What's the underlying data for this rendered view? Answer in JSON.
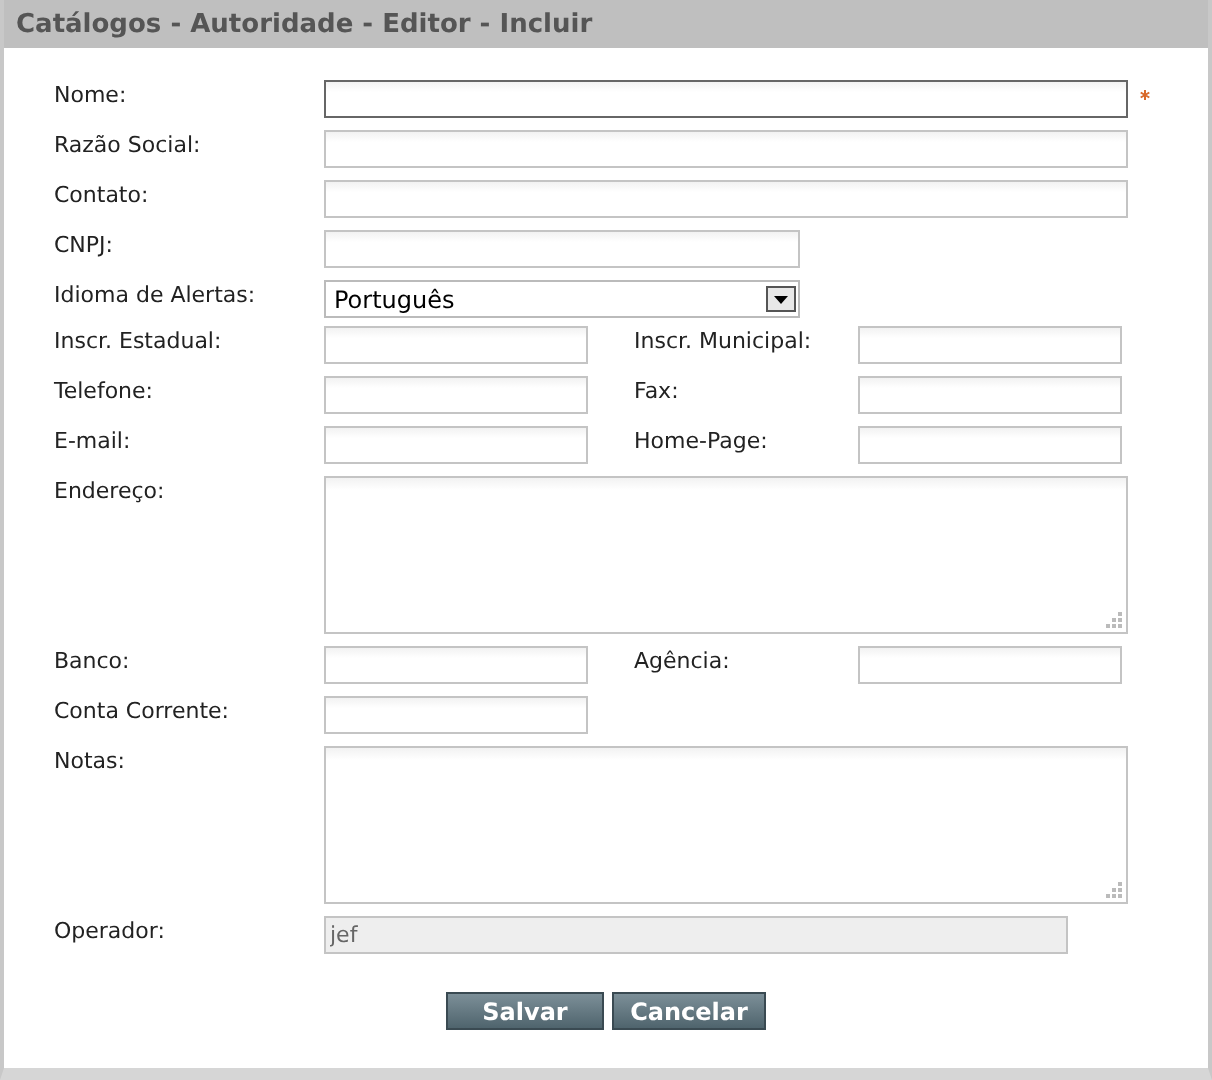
{
  "window": {
    "title": "Catálogos - Autoridade - Editor - Incluir"
  },
  "rows": [
    {
      "kind": "full",
      "label": "Nome:",
      "required": true,
      "focused": true
    },
    {
      "kind": "full",
      "label": "Razão Social:",
      "required": false,
      "focused": false
    },
    {
      "kind": "full",
      "label": "Contato:",
      "required": false,
      "focused": false
    },
    {
      "kind": "half",
      "label": "CNPJ:",
      "required": false,
      "focused": false
    },
    {
      "kind": "select",
      "label": "Idioma de Alertas:",
      "value": "Português"
    },
    {
      "kind": "pair",
      "label": "Inscr. Estadual:",
      "label_2": "Inscr. Municipal:"
    },
    {
      "kind": "pair",
      "label": "Telefone:",
      "label_2": "Fax:"
    },
    {
      "kind": "pair",
      "label": "E-mail:",
      "label_2": "Home-Page:"
    },
    {
      "kind": "textarea",
      "label": "Endereço:"
    },
    {
      "kind": "pair",
      "label": "Banco:",
      "label_2": "Agência:"
    },
    {
      "kind": "short",
      "label": "Conta Corrente:"
    },
    {
      "kind": "textarea",
      "label": "Notas:"
    },
    {
      "kind": "readonly",
      "label": "Operador:",
      "value": "jef",
      "disabled": true
    }
  ],
  "buttons": [
    "Salvar",
    "Cancelar"
  ]
}
